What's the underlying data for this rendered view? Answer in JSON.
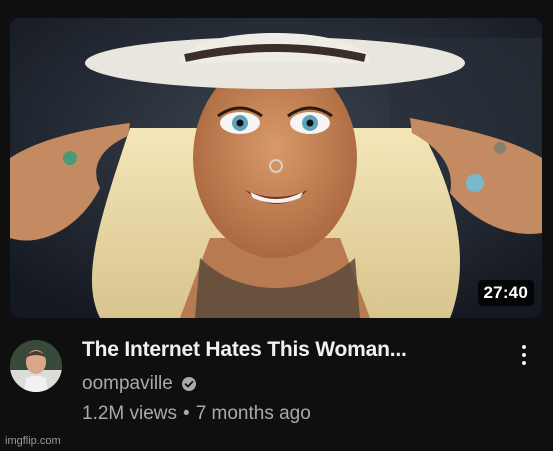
{
  "video": {
    "title": "The Internet Hates This Woman...",
    "duration": "27:40",
    "channel": "oompaville",
    "views": "1.2M views",
    "separator": "•",
    "published": "7 months ago",
    "verified_icon": "verified-check-icon",
    "menu_icon": "more-vert-icon"
  },
  "watermark": "imgflip.com",
  "colors": {
    "background": "#0f0f0f",
    "title": "#f1f1f1",
    "secondary_text": "#aaaaaa",
    "duration_badge": "#000000"
  }
}
